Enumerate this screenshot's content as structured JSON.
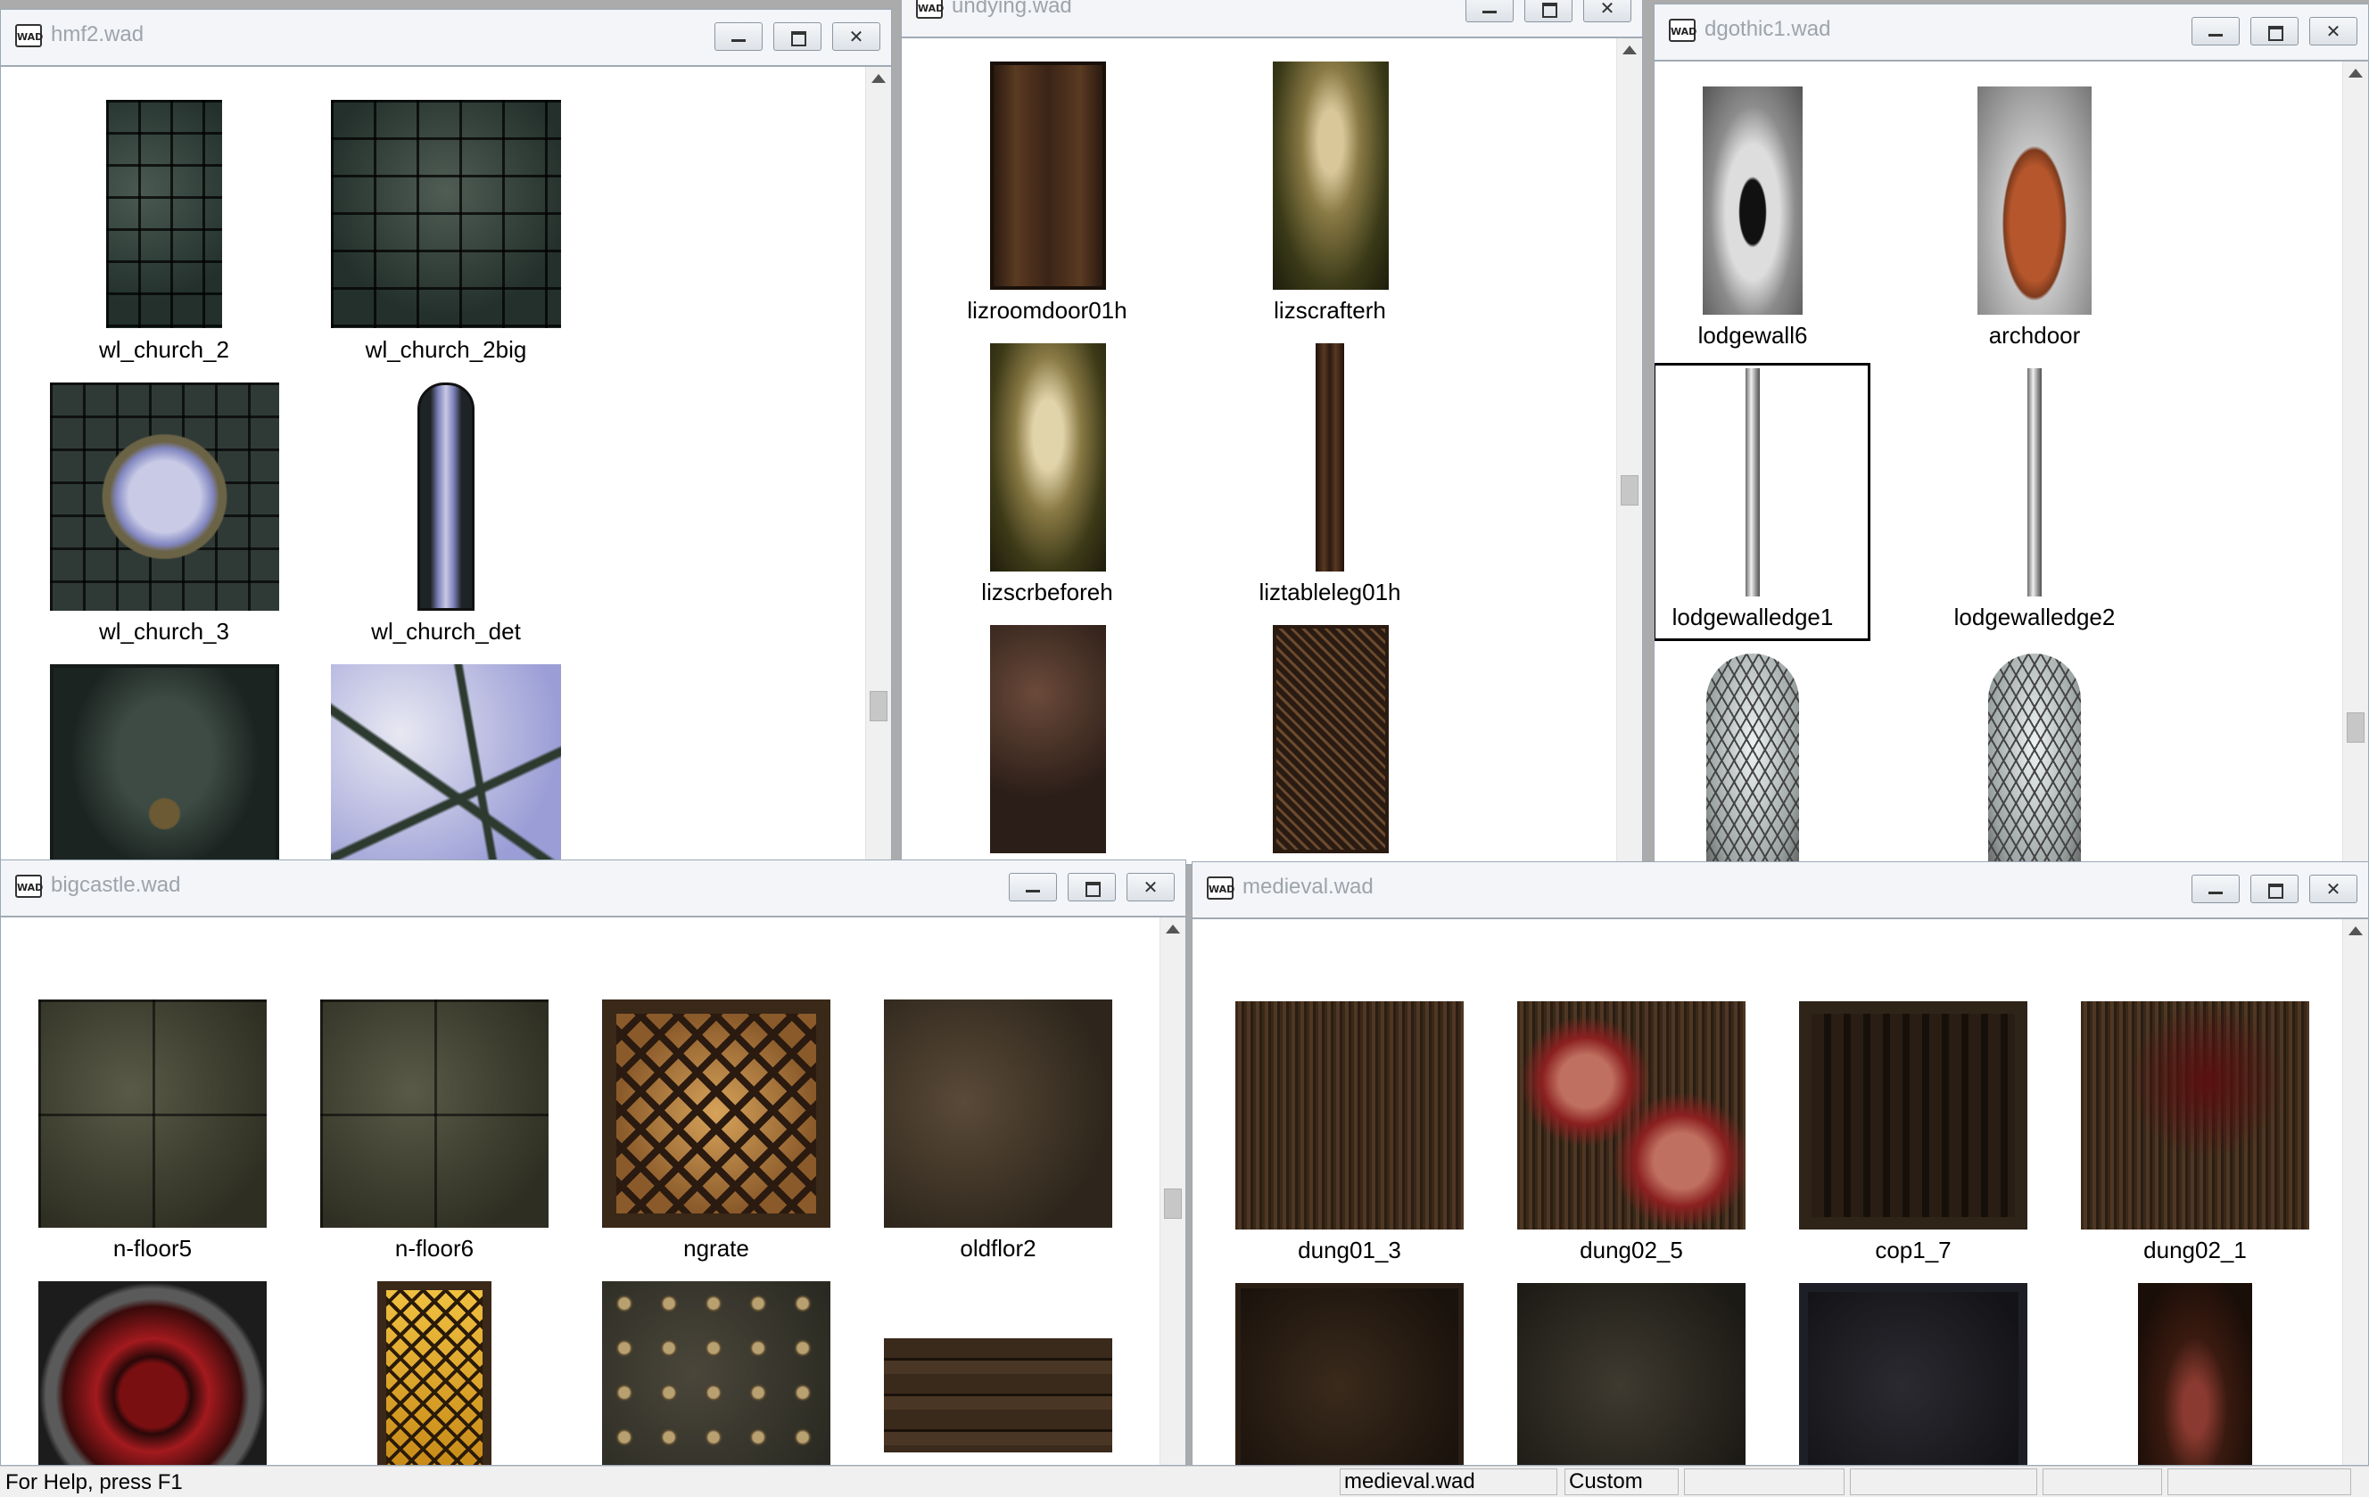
{
  "windows": {
    "hmf2": {
      "title": "hmf2.wad",
      "items": [
        "wl_church_2",
        "wl_church_2big",
        "wl_church_3",
        "wl_church_det"
      ]
    },
    "undying": {
      "title": "undying.wad",
      "items": [
        "lizroomdoor01h",
        "lizscrafterh",
        "lizscrbeforeh",
        "liztableleg01h"
      ]
    },
    "dgothic1": {
      "title": "dgothic1.wad",
      "items": [
        "lodgewall6",
        "archdoor",
        "lodgewalledge1",
        "lodgewalledge2"
      ],
      "selected": "lodgewalledge1"
    },
    "bigcastle": {
      "title": "bigcastle.wad",
      "items": [
        "n-floor5",
        "n-floor6",
        "ngrate",
        "oldflor2"
      ]
    },
    "medieval": {
      "title": "medieval.wad",
      "items": [
        "dung01_3",
        "dung02_5",
        "cop1_7",
        "dung02_1"
      ]
    }
  },
  "icons": {
    "app": "wad-file-icon",
    "minimize": "minimize-icon",
    "maximize": "maximize-icon",
    "close": "close-icon"
  },
  "statusbar": {
    "help": "For Help, press F1",
    "file": "medieval.wad",
    "mode": "Custom"
  }
}
